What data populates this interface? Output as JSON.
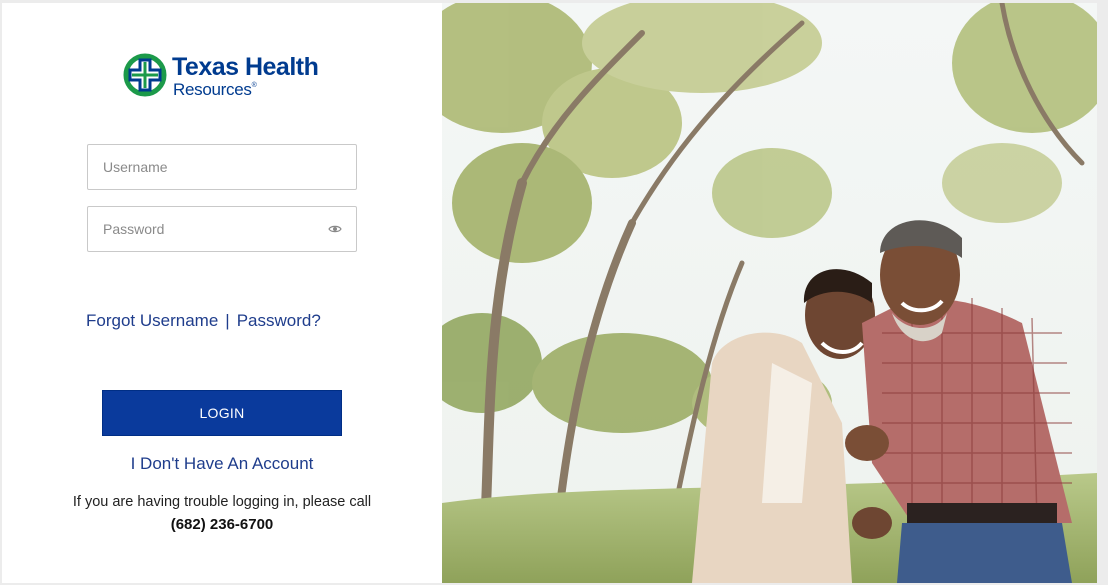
{
  "brand": {
    "name_line1": "Texas Health",
    "name_line2": "Resources",
    "registered_mark": "®",
    "primary_color": "#003b8f",
    "cross_color": "#1c9a4a"
  },
  "login_form": {
    "username_placeholder": "Username",
    "password_placeholder": "Password",
    "forgot_username_label": "Forgot Username",
    "separator": "|",
    "forgot_password_label": "Password?",
    "login_button_label": "LOGIN",
    "login_button_color": "#0a3a9c",
    "no_account_label": "I Don't Have An Account",
    "link_color": "#1f3d8c"
  },
  "help": {
    "trouble_text": "If you are having trouble logging in, please call",
    "phone": "(682) 236-6700"
  },
  "hero_image": {
    "icon": "photo-couple-outdoors"
  }
}
